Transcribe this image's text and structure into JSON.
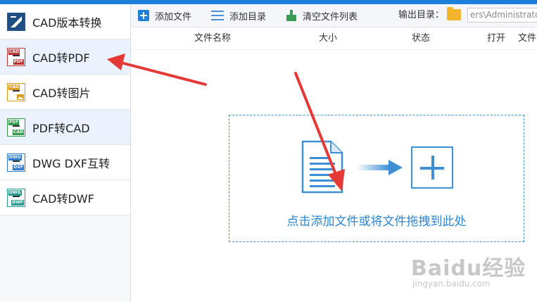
{
  "sidebar": {
    "items": [
      {
        "label": "CAD版本转换",
        "icon": "cad-version-icon",
        "tag": "",
        "tag2": ""
      },
      {
        "label": "CAD转PDF",
        "icon": "cad-to-pdf-icon",
        "tag": "CAD",
        "tag2": "PDF"
      },
      {
        "label": "CAD转图片",
        "icon": "cad-to-image-icon",
        "tag": "CAD",
        "tag2": ""
      },
      {
        "label": "PDF转CAD",
        "icon": "pdf-to-cad-icon",
        "tag": "PDF",
        "tag2": "CAD"
      },
      {
        "label": "DWG DXF互转",
        "icon": "dwg-dxf-icon",
        "tag": "DWG",
        "tag2": "DXF"
      },
      {
        "label": "CAD转DWF",
        "icon": "cad-to-dwf-icon",
        "tag": "DWG",
        "tag2": "DWF"
      }
    ]
  },
  "toolbar": {
    "add_file": "添加文件",
    "add_dir": "添加目录",
    "clear_list": "清空文件列表",
    "output_label": "输出目录：",
    "output_path": "ers\\Administrator"
  },
  "table": {
    "columns": [
      "文件名称",
      "大小",
      "状态",
      "打开",
      "文件"
    ]
  },
  "dropzone": {
    "text": "点击添加文件或将文件拖拽到此处"
  },
  "watermark": {
    "text": "Baidu经验",
    "sub": "jingyan.baidu.com"
  },
  "colors": {
    "accent": "#1e7fd8",
    "dropzone": "#3f8fd5",
    "annotation_arrow": "#e53935"
  }
}
